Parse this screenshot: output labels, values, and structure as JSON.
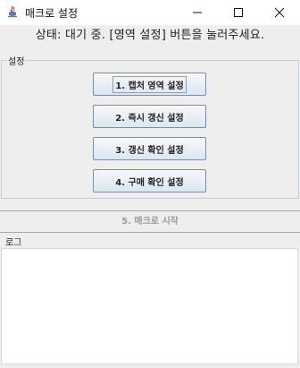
{
  "window": {
    "title": "매크로 설정"
  },
  "status": {
    "text": "상태: 대기 중. [영역 설정] 버튼을 눌러주세요."
  },
  "settings_group": {
    "title": "설정",
    "buttons": [
      {
        "label": "1. 캡처 영역 설정"
      },
      {
        "label": "2. 즉시 갱신 설정"
      },
      {
        "label": "3. 갱신 확인 설정"
      },
      {
        "label": "4. 구매 확인 설정"
      }
    ]
  },
  "start_button": {
    "label": "5. 매크로 시작"
  },
  "log": {
    "title": "로그",
    "content": ""
  },
  "colors": {
    "background": "#eeeeee",
    "button_border": "#7a8ea6",
    "disabled_text": "#9a9a9a"
  }
}
